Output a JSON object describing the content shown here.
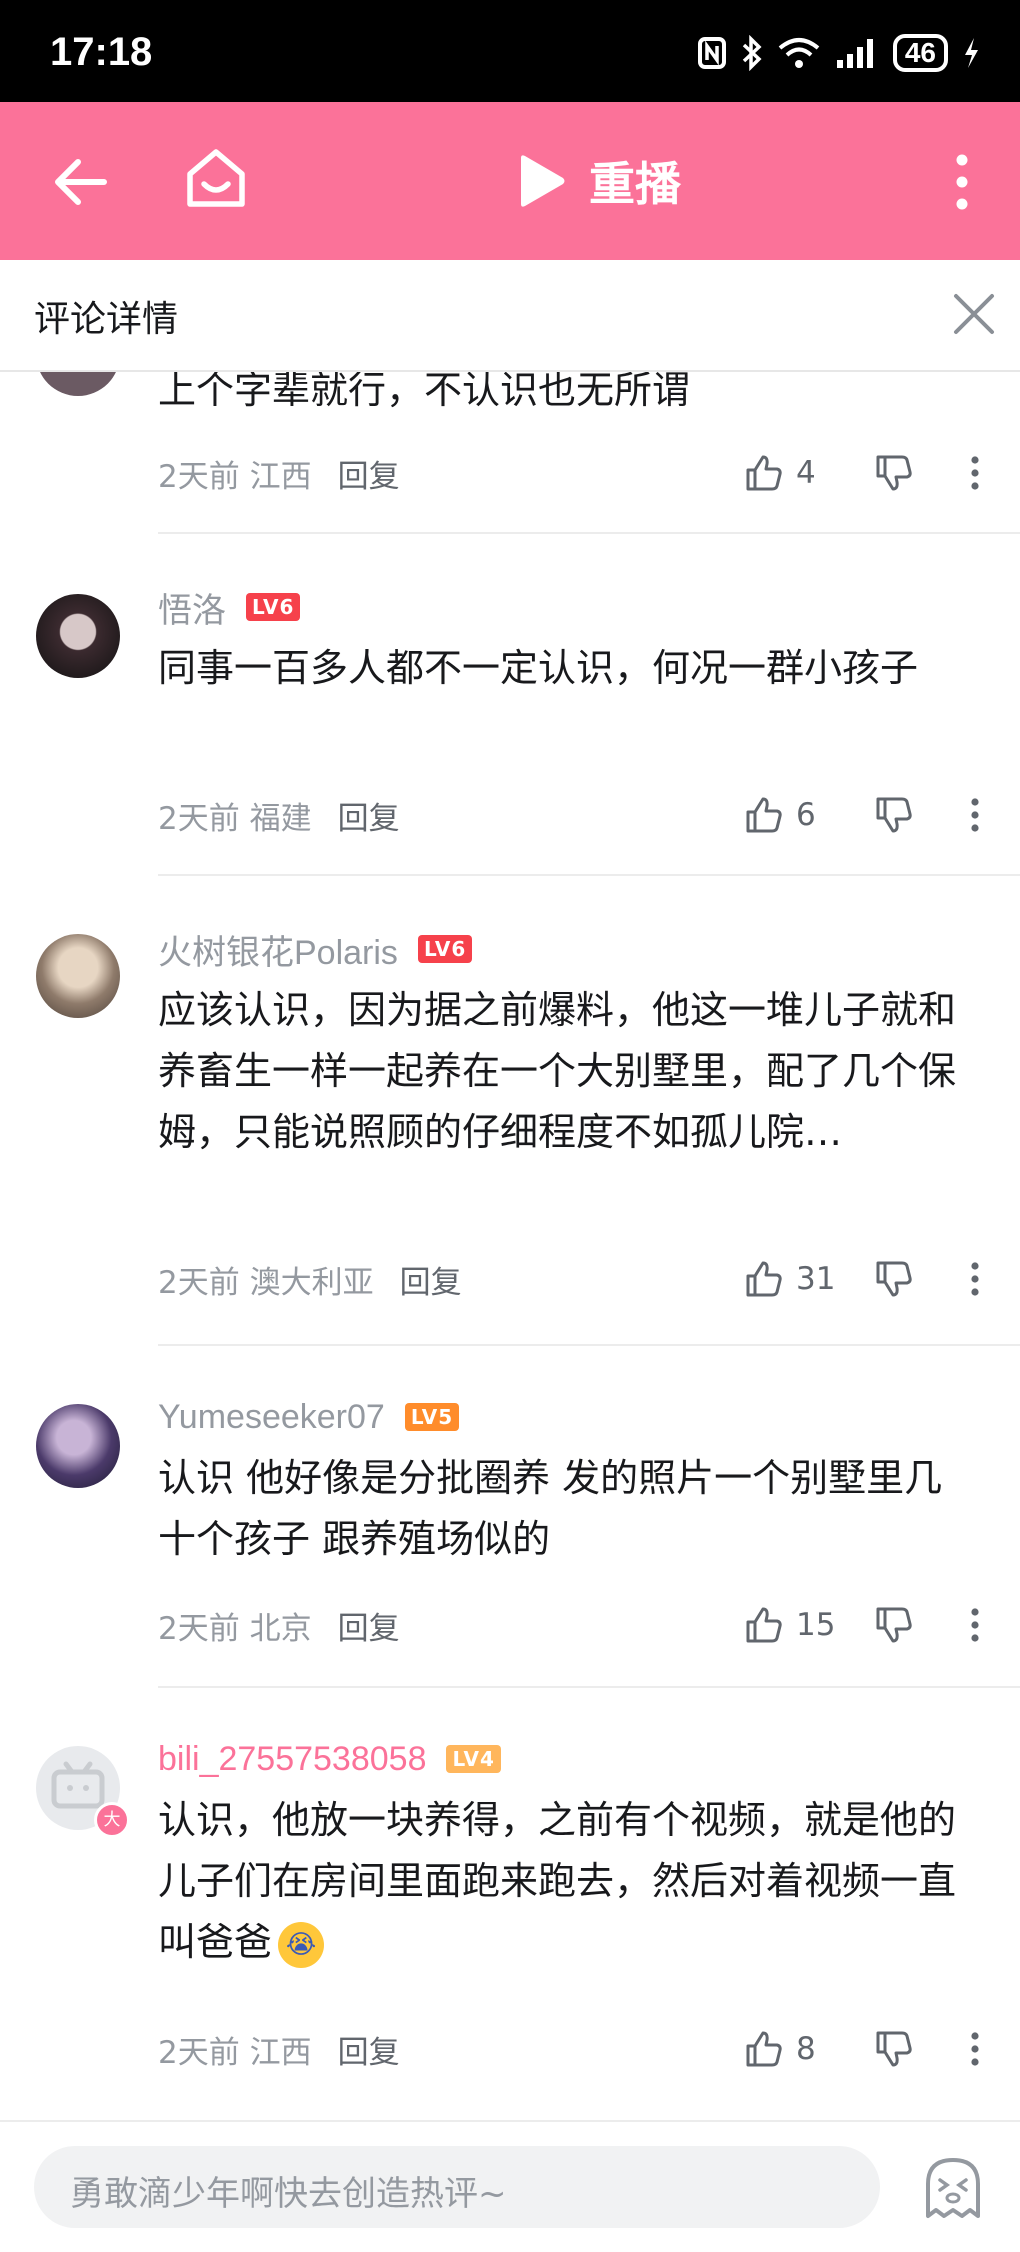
{
  "status_bar": {
    "time": "17:18",
    "battery": "46"
  },
  "nav": {
    "replay_label": "重播"
  },
  "header": {
    "title": "评论详情"
  },
  "comments": [
    {
      "user": "",
      "level": "",
      "text": "上个字辈就行，不认识也无所谓",
      "time_location": "2天前 江西",
      "reply": "回复",
      "likes": "4"
    },
    {
      "user": "悟洛",
      "level": "LV6",
      "text": "同事一百多人都不一定认识，何况一群小孩子",
      "time_location": "2天前 福建",
      "reply": "回复",
      "likes": "6"
    },
    {
      "user": "火树银花Polaris",
      "level": "LV6",
      "text": "应该认识，因为据之前爆料，他这一堆儿子就和养畜生一样一起养在一个大别墅里，配了几个保姆，只能说照顾的仔细程度不如孤儿院…",
      "time_location": "2天前 澳大利亚",
      "reply": "回复",
      "likes": "31"
    },
    {
      "user": "Yumeseeker07",
      "level": "LV5",
      "text": "认识 他好像是分批圈养 发的照片一个别墅里几十个孩子 跟养殖场似的",
      "time_location": "2天前 北京",
      "reply": "回复",
      "likes": "15"
    },
    {
      "user": "bili_27557538058",
      "level": "LV4",
      "text": "认识，他放一块养得，之前有个视频，就是他的儿子们在房间里面跑来跑去，然后对着视频一直叫爸爸",
      "emoji": "😭",
      "time_location": "2天前 江西",
      "reply": "回复",
      "likes": "8",
      "avatar_badge": "大"
    }
  ],
  "footer": {
    "placeholder": "勇敢滴少年啊快去创造热评~"
  },
  "colors": {
    "brand_pink": "#fb7299",
    "lv6": "#f6414b",
    "lv5": "#ff8c2b",
    "lv4": "#ffb65c",
    "text_gray": "#9499a0"
  }
}
